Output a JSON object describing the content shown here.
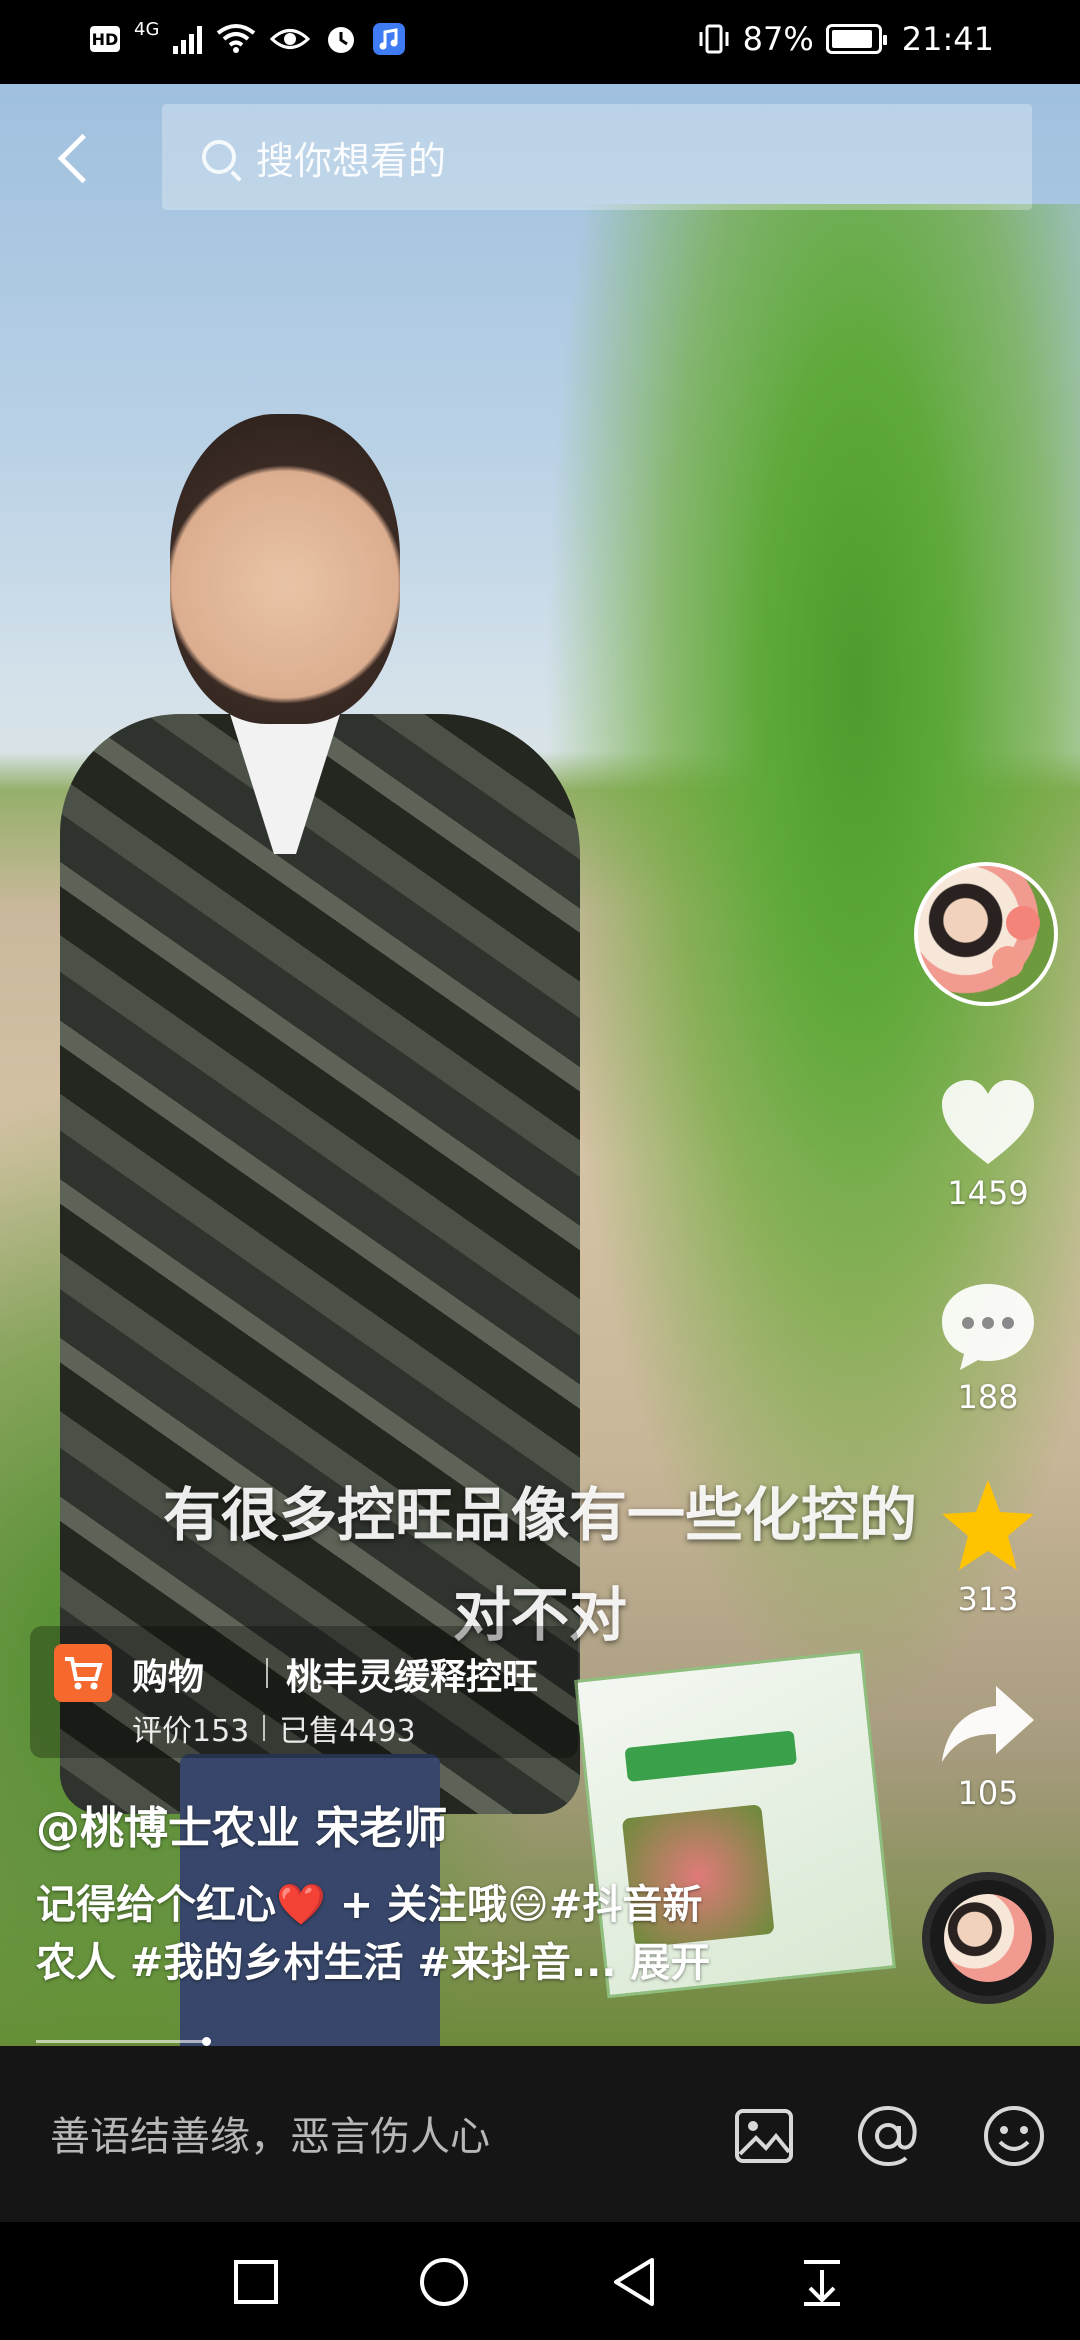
{
  "status_bar": {
    "hd": "HD",
    "network": "4G",
    "battery_pct": "87%",
    "time": "21:41"
  },
  "search": {
    "placeholder": "搜你想看的"
  },
  "subtitles": {
    "line1": "有很多控旺品像有一些化控的",
    "line2": "对不对"
  },
  "rail": {
    "likes": "1459",
    "comments": "188",
    "favorites": "313",
    "shares": "105"
  },
  "shop": {
    "label": "购物",
    "title": "桃丰灵缓释控旺",
    "reviews": "评价153",
    "sold": "已售4493"
  },
  "post": {
    "author": "@桃博士农业 宋老师",
    "desc_line1": "记得给个红心❤️ + 关注哦😄#抖音新",
    "desc_line2": "农人 #我的乡村生活 #来抖音...",
    "expand_label": "展开"
  },
  "comment_bar": {
    "placeholder": "善语结善缘，恶言伤人心"
  },
  "colors": {
    "star": "#FFC300",
    "cart": "#F6692E"
  }
}
